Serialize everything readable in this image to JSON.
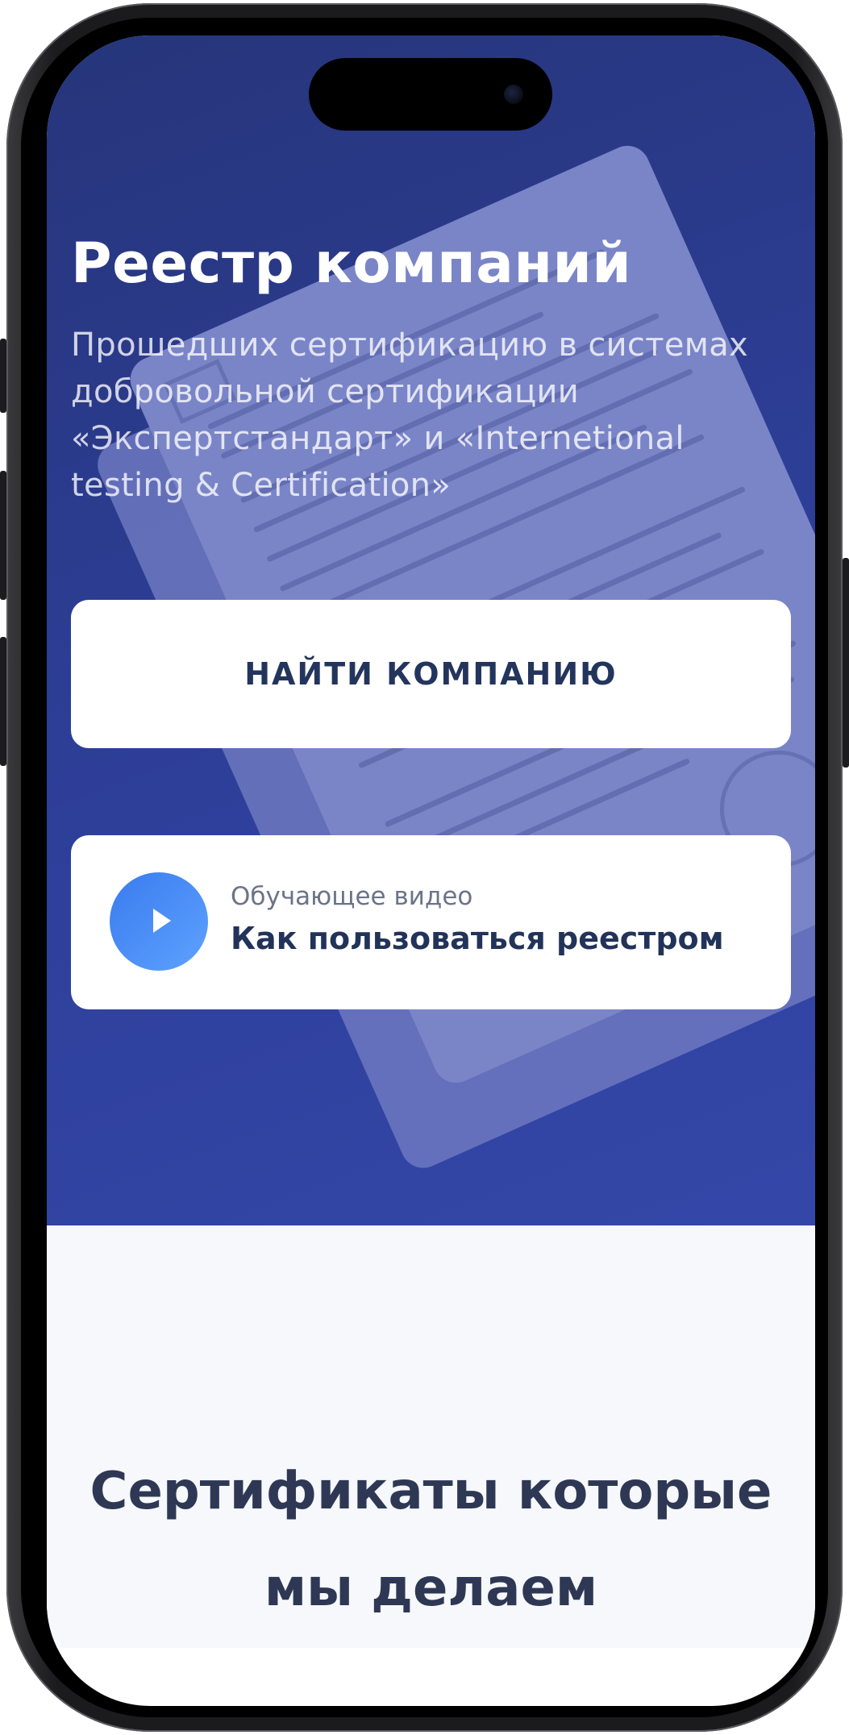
{
  "hero": {
    "title": "Реестр компаний",
    "subtitle": "Прошедших сертификацию в системах добровольной сертификации «Экспертстандарт» и «Internetional testing & Certification»",
    "find_button": "НАЙТИ КОМПАНИЮ",
    "video": {
      "subtitle": "Обучающее видео",
      "title": "Как пользоваться реестром",
      "icon": "play-icon"
    }
  },
  "certificates_section": {
    "title": "Сертификаты которые мы делаем"
  },
  "colors": {
    "hero_bg": "#2e3f9a",
    "accent": "#3a7bee",
    "dark_text": "#23355c",
    "section_bg": "#f6f8fb"
  }
}
